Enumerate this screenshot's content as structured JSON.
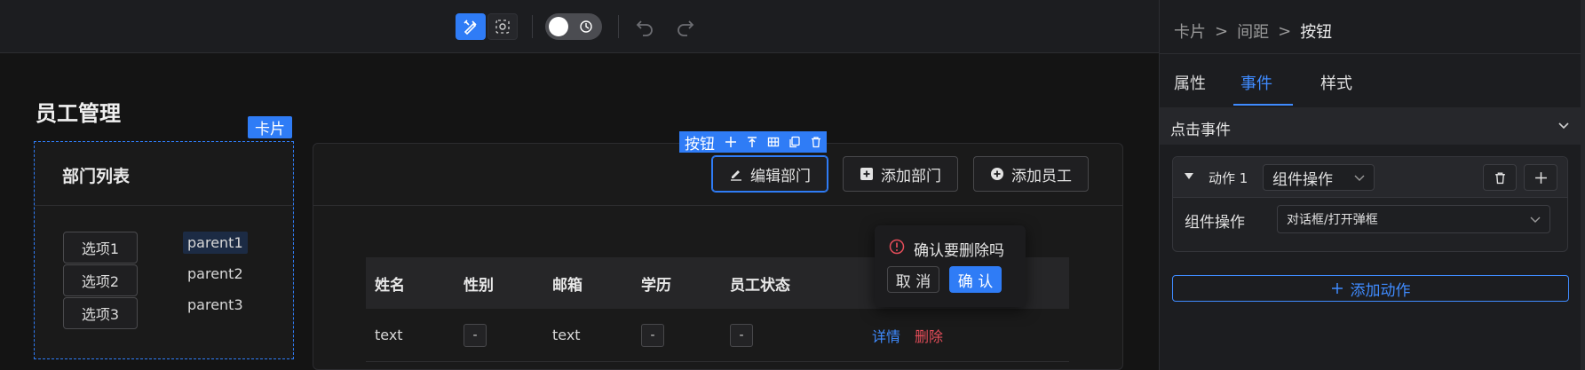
{
  "page": {
    "title": "员工管理"
  },
  "left_card": {
    "tag": "卡片",
    "title": "部门列表",
    "options": [
      "选项1",
      "选项2",
      "选项3"
    ],
    "tree": [
      "parent1",
      "parent2",
      "parent3"
    ]
  },
  "right_card": {
    "component_toolbar": {
      "label": "按钮",
      "icons": [
        "move-icon",
        "align-top-icon",
        "grid-icon",
        "copy-icon",
        "trash-icon"
      ]
    },
    "buttons": {
      "edit": "编辑部门",
      "add_dept": "添加部门",
      "add_emp": "添加员工"
    },
    "table": {
      "columns": [
        "姓名",
        "性别",
        "邮箱",
        "学历",
        "员工状态"
      ],
      "rows": [
        {
          "name": "text",
          "gender": "-",
          "email": "text",
          "edu": "-",
          "status": "-",
          "detail": "详情",
          "delete": "删除"
        }
      ]
    },
    "popconfirm": {
      "message": "确认要删除吗",
      "cancel": "取 消",
      "ok": "确 认"
    }
  },
  "panel": {
    "breadcrumb": [
      "卡片",
      "间距",
      "按钮"
    ],
    "tabs": [
      "属性",
      "事件",
      "样式"
    ],
    "active_tab": "事件",
    "section": "点击事件",
    "action": {
      "label": "动作 1",
      "type_value": "组件操作",
      "field_label": "组件操作",
      "field_value": "对话框/打开弹框"
    },
    "add_action": "添加动作"
  },
  "colors": {
    "accent": "#2f7cf6",
    "danger": "#e34d59",
    "link": "#3f8bff"
  }
}
